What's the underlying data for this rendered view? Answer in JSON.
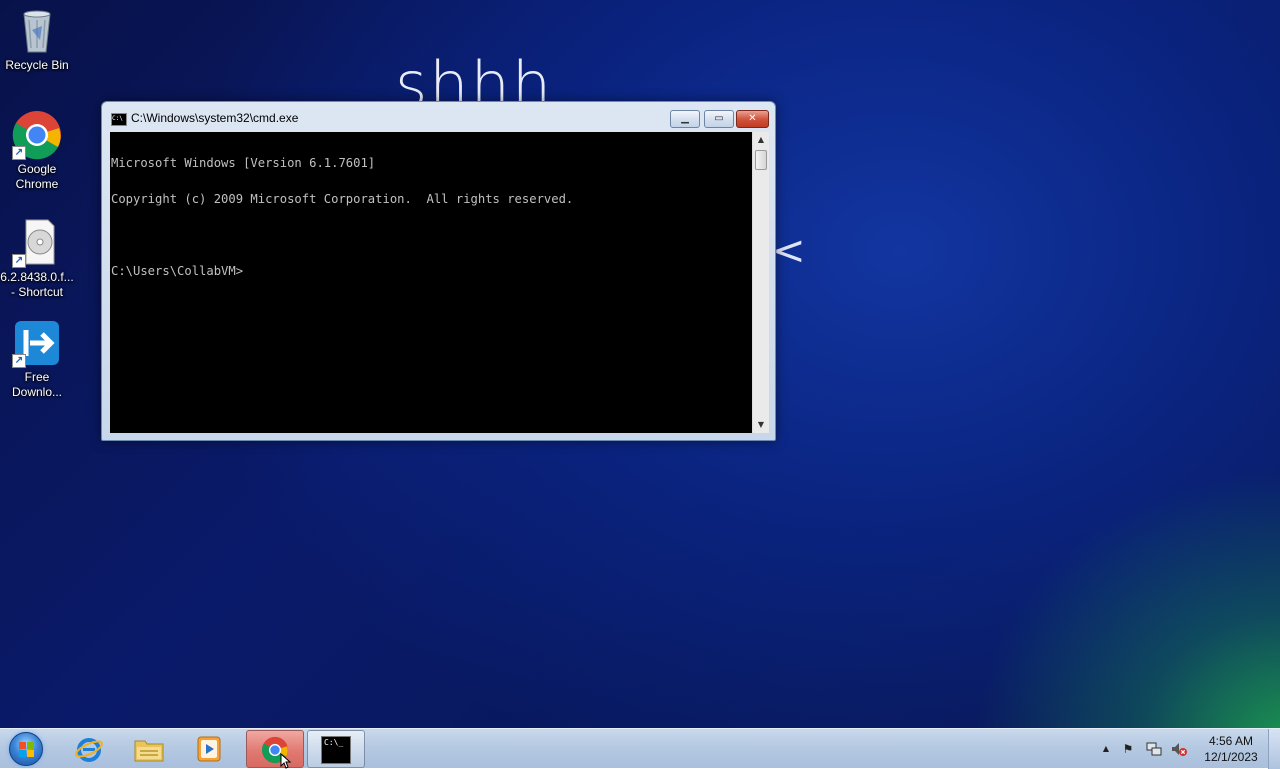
{
  "desktop": {
    "wallpaper_text": "shhh",
    "wallpaper_glyph": "<",
    "icons": [
      {
        "label_line1": "Recycle Bin",
        "label_line2": "",
        "icon": "recycle-bin-icon"
      },
      {
        "label_line1": "Google",
        "label_line2": "Chrome",
        "icon": "chrome-icon"
      },
      {
        "label_line1": "6.2.8438.0.f...",
        "label_line2": "- Shortcut",
        "icon": "disc-image-icon"
      },
      {
        "label_line1": "Free",
        "label_line2": "Downlo...",
        "icon": "free-download-manager-icon"
      }
    ]
  },
  "cmd_window": {
    "title": "C:\\Windows\\system32\\cmd.exe",
    "title_icon_text": "C:\\",
    "console_lines": [
      "Microsoft Windows [Version 6.1.7601]",
      "Copyright (c) 2009 Microsoft Corporation.  All rights reserved.",
      "",
      "C:\\Users\\CollabVM>"
    ],
    "minimize_glyph": "▁",
    "maximize_glyph": "▭",
    "close_glyph": "✕",
    "scroll_up_glyph": "▲",
    "scroll_down_glyph": "▼"
  },
  "taskbar": {
    "items": [
      {
        "icon": "internet-explorer-icon"
      },
      {
        "icon": "file-explorer-icon"
      },
      {
        "icon": "media-player-icon"
      },
      {
        "icon": "chrome-icon"
      },
      {
        "icon": "cmd-icon"
      }
    ],
    "cmd_icon_text": "C:\\_",
    "tray": {
      "show_hidden_glyph": "▲",
      "flag_glyph": "⚑"
    },
    "clock": {
      "time": "4:56 AM",
      "date": "12/1/2023"
    }
  },
  "colors": {
    "console_bg": "#000000",
    "console_fg": "#c0c0c0",
    "close_button": "#c8462f"
  }
}
